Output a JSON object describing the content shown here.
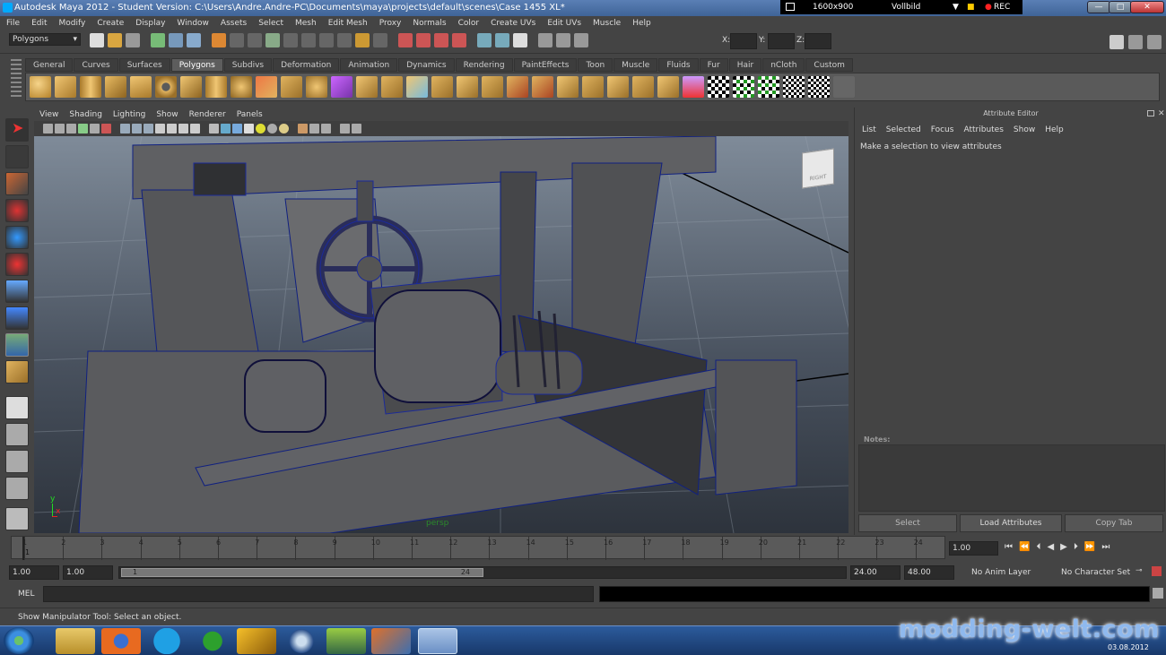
{
  "window": {
    "title": "Autodesk Maya 2012 - Student Version: C:\\Users\\Andre.Andre-PC\\Documents\\maya\\projects\\default\\scenes\\Case 1455 XL*",
    "minimize": "—",
    "maximize": "□",
    "close": "✕"
  },
  "recorder": {
    "resolution": "1600x900",
    "mode": "Vollbild",
    "rec": "REC"
  },
  "menu": [
    "File",
    "Edit",
    "Modify",
    "Create",
    "Display",
    "Window",
    "Assets",
    "Select",
    "Mesh",
    "Edit Mesh",
    "Proxy",
    "Normals",
    "Color",
    "Create UVs",
    "Edit UVs",
    "Muscle",
    "Help"
  ],
  "status_line": {
    "mode": "Polygons",
    "x_label": "X:",
    "y_label": "Y:",
    "z_label": "Z:"
  },
  "shelf_tabs": [
    "General",
    "Curves",
    "Surfaces",
    "Polygons",
    "Subdivs",
    "Deformation",
    "Animation",
    "Dynamics",
    "Rendering",
    "PaintEffects",
    "Toon",
    "Muscle",
    "Fluids",
    "Fur",
    "Hair",
    "nCloth",
    "Custom"
  ],
  "active_shelf": "Polygons",
  "panel_menu": [
    "View",
    "Shading",
    "Lighting",
    "Show",
    "Renderer",
    "Panels"
  ],
  "viewport": {
    "camera_label": "persp",
    "viewcube": "RIGHT",
    "axis_x": "x",
    "axis_y": "y"
  },
  "attribute_editor": {
    "title": "Attribute Editor",
    "menu": [
      "List",
      "Selected",
      "Focus",
      "Attributes",
      "Show",
      "Help"
    ],
    "message": "Make a selection to view attributes",
    "notes_label": "Notes:",
    "buttons": {
      "select": "Select",
      "load": "Load Attributes",
      "copy": "Copy Tab"
    }
  },
  "timeline": {
    "ticks": [
      "1",
      "2",
      "3",
      "4",
      "5",
      "6",
      "7",
      "8",
      "9",
      "10",
      "11",
      "12",
      "13",
      "14",
      "15",
      "16",
      "17",
      "18",
      "19",
      "20",
      "21",
      "22",
      "23",
      "24"
    ],
    "current_frame": "1",
    "current_time": "1.00"
  },
  "range": {
    "start": "1.00",
    "playback_start": "1.00",
    "slider_start": "1",
    "slider_end": "24",
    "playback_end": "24.00",
    "end": "48.00",
    "anim_layer": "No Anim Layer",
    "character_set": "No Character Set"
  },
  "command_line": {
    "label": "MEL"
  },
  "help_line": "Show Manipulator Tool: Select an object.",
  "taskbar": {
    "date": "03.08.2012"
  },
  "watermark": "modding-welt.com"
}
